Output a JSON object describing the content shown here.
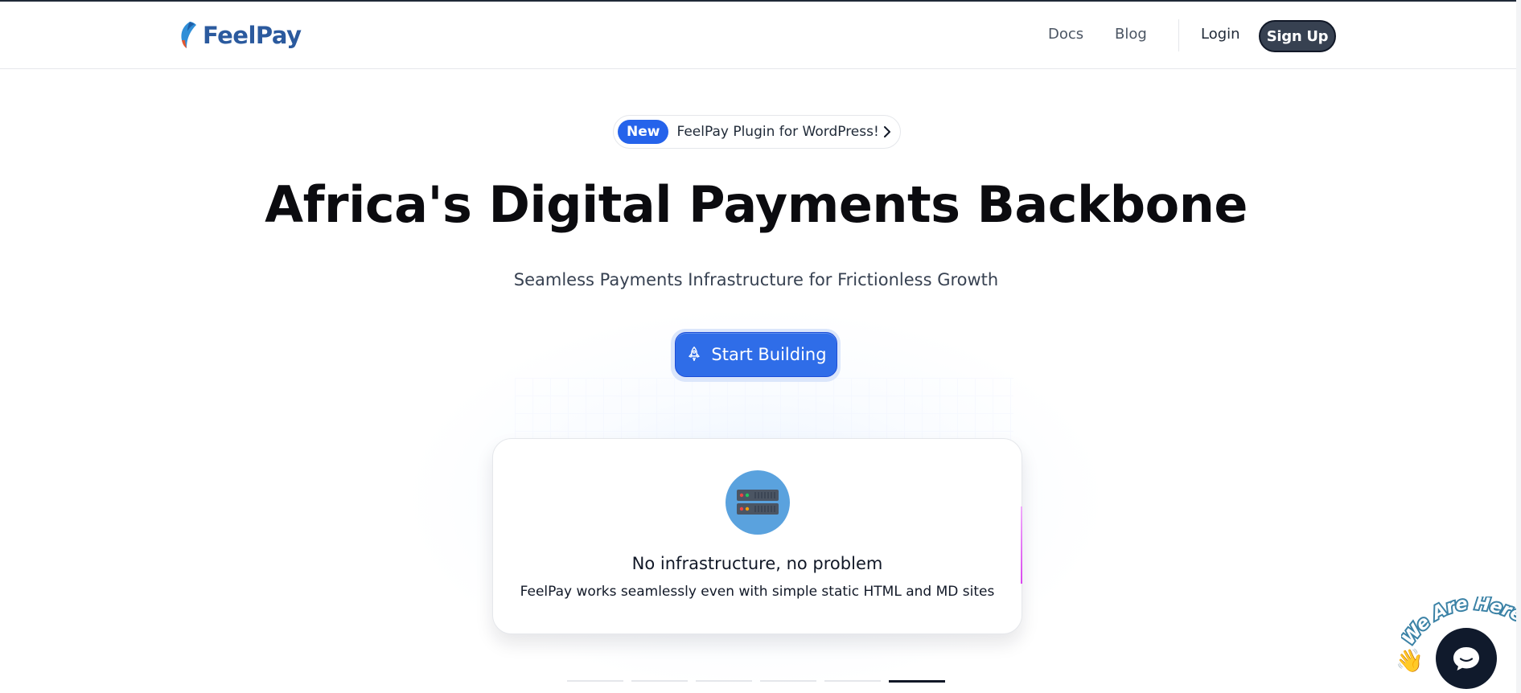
{
  "brand": {
    "name": "FeelPay"
  },
  "nav": {
    "docs": "Docs",
    "blog": "Blog",
    "login": "Login",
    "signup": "Sign Up"
  },
  "announcement": {
    "badge": "New",
    "text": "FeelPay Plugin for WordPress!"
  },
  "hero": {
    "title": "Africa's Digital Payments Backbone",
    "subtitle": "Seamless Payments Infrastructure for Frictionless Growth",
    "cta": "Start Building"
  },
  "feature_card": {
    "icon": "server-icon",
    "title": "No infrastructure, no problem",
    "description": "FeelPay works seamlessly even with simple static HTML and MD sites"
  },
  "carousel": {
    "count": 6,
    "active_index": 5
  },
  "chat_widget": {
    "label": "We Are Here!",
    "icon": "chat-bubble-icon"
  },
  "colors": {
    "primary": "#2f6de8",
    "brand_text": "#2b5a9e",
    "signup_bg": "#374151",
    "chat_bg": "#101a2c"
  }
}
